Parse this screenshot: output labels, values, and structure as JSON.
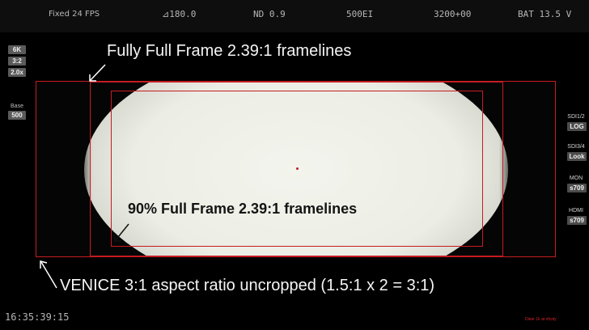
{
  "status_bar": {
    "fps": "Fixed 24 FPS",
    "shutter": "⊿180.0",
    "nd": "ND 0.9",
    "ei": "500EI",
    "white_balance": "3200+00",
    "battery": "BAT 13.5 V"
  },
  "left_panel": {
    "resolution": "6K",
    "aspect": "3:2",
    "squeeze": "2.0x",
    "base_label": "Base",
    "base_value": "500"
  },
  "right_panel": {
    "sdi12_label": "SDI1/2",
    "sdi12_value": "LOG",
    "sdi34_label": "SDI3/4",
    "sdi34_value": "Look",
    "mon_label": "MON",
    "mon_value": "s709",
    "hdmi_label": "HDMI",
    "hdmi_value": "s709"
  },
  "annotations": {
    "full_frame": "Fully Full Frame 2.39:1 framelines",
    "ninety_percent": "90% Full Frame 2.39:1 framelines",
    "uncropped": "VENICE 3:1 aspect ratio uncropped (1.5:1 x 2 = 3:1)"
  },
  "timecode": "16:35:39:15",
  "warning_text": "Dleer 1k at nfcoly",
  "colors": {
    "frameline": "#c51b22",
    "background": "#000000",
    "status_text": "#b6b6b6"
  }
}
